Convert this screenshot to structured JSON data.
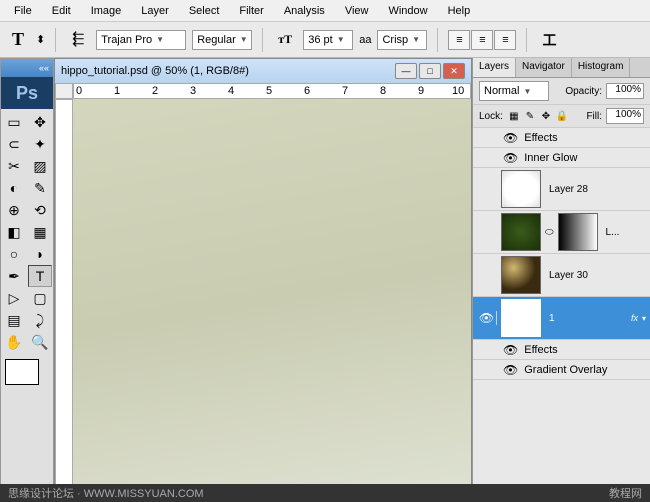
{
  "menu": [
    "File",
    "Edit",
    "Image",
    "Layer",
    "Select",
    "Filter",
    "Analysis",
    "View",
    "Window",
    "Help"
  ],
  "options": {
    "font_family": "Trajan Pro",
    "font_style": "Regular",
    "font_size": "36 pt",
    "aa_label": "aa",
    "aa_mode": "Crisp"
  },
  "document": {
    "title": "hippo_tutorial.psd @ 50% (1, RGB/8#)"
  },
  "ruler_marks": [
    "0",
    "1",
    "2",
    "3",
    "4",
    "5",
    "6",
    "7",
    "8",
    "9",
    "10"
  ],
  "panels": {
    "tabs": [
      "Layers",
      "Navigator",
      "Histogram"
    ],
    "blend_mode": "Normal",
    "opacity_label": "Opacity:",
    "opacity_value": "100%",
    "lock_label": "Lock:",
    "fill_label": "Fill:",
    "fill_value": "100%"
  },
  "layers": {
    "effects_label": "Effects",
    "inner_glow": "Inner Glow",
    "layer28": "Layer 28",
    "layer_l": "L...",
    "layer30": "Layer 30",
    "layer1": "1",
    "fx": "fx",
    "gradient_overlay": "Gradient Overlay"
  },
  "footer": {
    "left": "思缘设计论坛 · WWW.MISSYUAN.COM",
    "right": "教程网"
  }
}
